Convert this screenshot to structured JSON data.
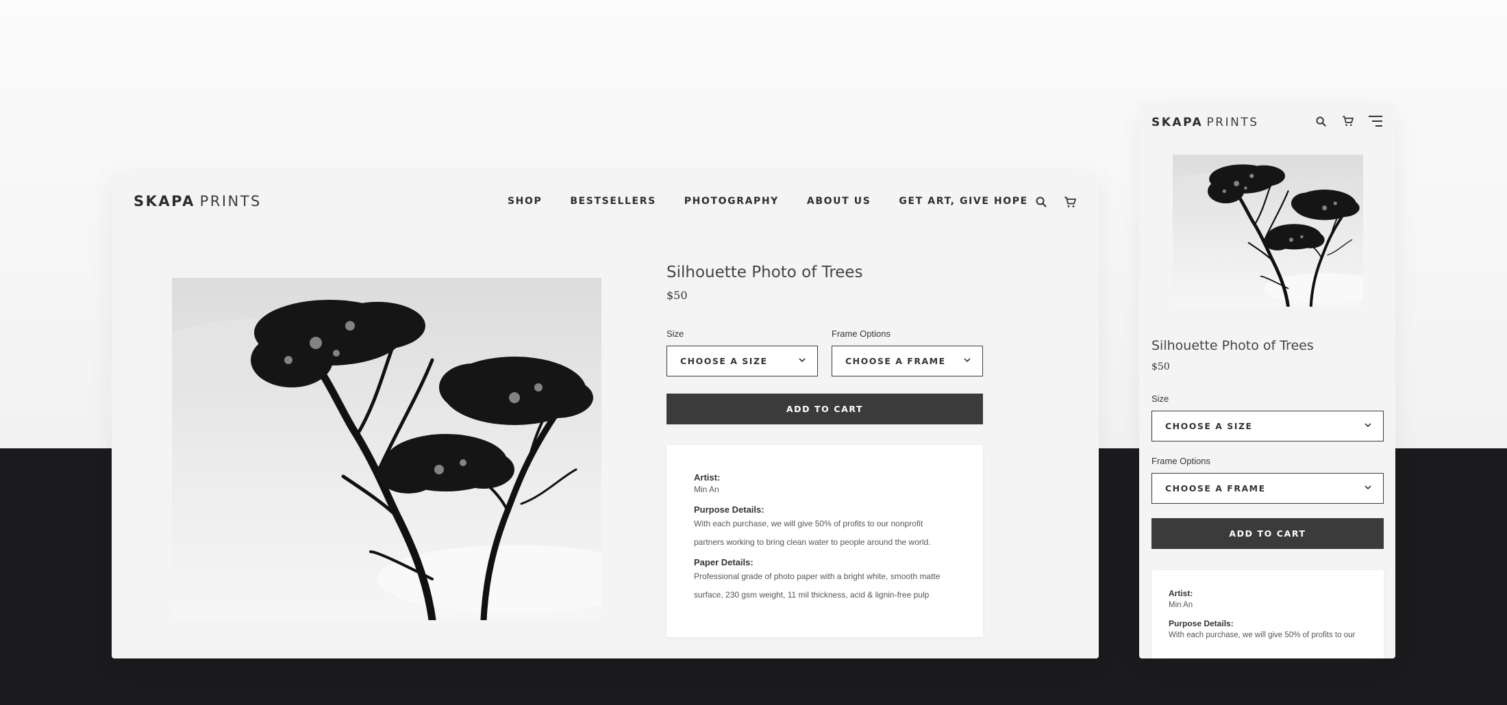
{
  "brand": {
    "bold": "SKAPA",
    "thin": "PRINTS"
  },
  "nav": [
    "SHOP",
    "BESTSELLERS",
    "PHOTOGRAPHY",
    "ABOUT US",
    "GET ART, GIVE HOPE"
  ],
  "icons": {
    "search": "search-icon",
    "cart": "cart-icon",
    "menu": "menu-icon",
    "chevron": "chevron-down-icon"
  },
  "product": {
    "title": "Silhouette Photo of Trees",
    "price": "$50",
    "size_label": "Size",
    "size_value": "CHOOSE A SIZE",
    "frame_label": "Frame Options",
    "frame_value": "CHOOSE A FRAME",
    "add_to_cart": "ADD TO CART"
  },
  "details": {
    "artist_label": "Artist:",
    "artist": "Min An",
    "purpose_label": "Purpose Details:",
    "purpose_line1": "With each purchase, we will give 50% of profits to our nonprofit",
    "purpose_line2": "partners working to bring clean water to people around the world.",
    "paper_label": "Paper Details:",
    "paper_line1": "Professional grade of photo paper with a bright white, smooth matte",
    "paper_line2": "surface, 230 gsm weight, 11 mil thickness, acid & lignin-free pulp"
  },
  "mobile_details": {
    "purpose_line1": "With each purchase, we will give 50% of profits to our"
  },
  "colors": {
    "accent_button": "#3b3b3b",
    "dark_band": "#1b1b1d",
    "page": "#f4f4f4"
  }
}
